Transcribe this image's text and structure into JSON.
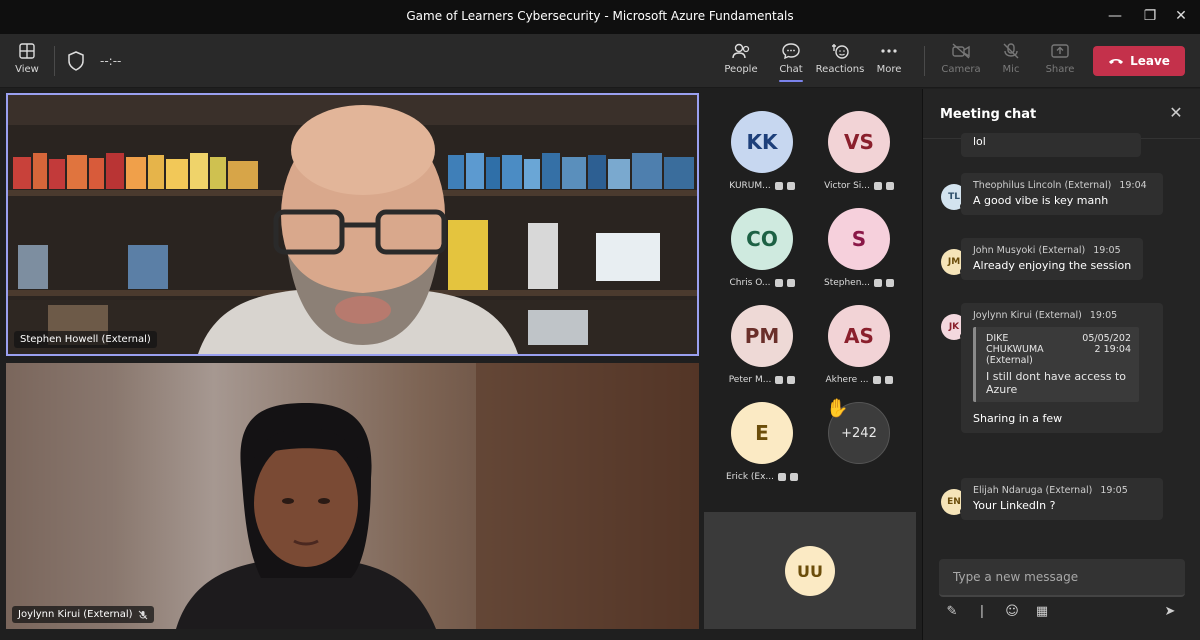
{
  "window": {
    "title": "Game of Learners Cybersecurity - Microsoft Azure Fundamentals"
  },
  "toolbar": {
    "view_label": "View",
    "timer": "--:--",
    "people_label": "People",
    "chat_label": "Chat",
    "reactions_label": "Reactions",
    "more_label": "More",
    "camera_label": "Camera",
    "mic_label": "Mic",
    "share_label": "Share",
    "leave_label": "Leave"
  },
  "videos": [
    {
      "name": "Stephen Howell (External)"
    },
    {
      "name": "Joylynn Kirui (External)"
    }
  ],
  "participants": [
    {
      "initials": "KK",
      "name": "KURUM...",
      "bg": "#c7d7f0",
      "fg": "#1d3f7a"
    },
    {
      "initials": "VS",
      "name": "Victor Si...",
      "bg": "#f2d3d6",
      "fg": "#8a1f2c"
    },
    {
      "initials": "CO",
      "name": "Chris O...",
      "bg": "#cfeadf",
      "fg": "#1d6144"
    },
    {
      "initials": "S",
      "name": "Stephen...",
      "bg": "#f6d0dc",
      "fg": "#8a1747"
    },
    {
      "initials": "PM",
      "name": "Peter M...",
      "bg": "#eed9d6",
      "fg": "#6a2f2a"
    },
    {
      "initials": "AS",
      "name": "Akhere ...",
      "bg": "#f2d3d6",
      "fg": "#8a1f2c"
    },
    {
      "initials": "E",
      "name": "Erick (Ex...",
      "bg": "#fbeac4",
      "fg": "#6b4d0a"
    }
  ],
  "overflow": {
    "count": "+242"
  },
  "self_tile": {
    "initials": "UU"
  },
  "chat": {
    "title": "Meeting chat",
    "partial_text": "lol",
    "messages": [
      {
        "initials": "TL",
        "name": "Theophilus Lincoln (External)",
        "time": "19:04",
        "text": "A good vibe is key manh",
        "bg": "#d3e3ef",
        "fg": "#2d4f6b",
        "dot": "#c7c7c7"
      },
      {
        "initials": "JM",
        "name": "John Musyoki (External)",
        "time": "19:05",
        "text": "Already enjoying the session",
        "bg": "#f5e4b8",
        "fg": "#6b4d0a",
        "dot": "#c7c7c7"
      },
      {
        "initials": "JK",
        "name": "Joylynn Kirui (External)",
        "time": "19:05",
        "text": "Sharing in a few",
        "bg": "#f3d8de",
        "fg": "#8a1f2c",
        "dot": "#c4314b",
        "quote": {
          "author_line1": "DIKE",
          "date": "05/05/202",
          "author_line2": "CHUKWUMA",
          "time": "2 19:04",
          "author_line3": "(External)",
          "text": "I still dont have access to Azure"
        }
      },
      {
        "initials": "EN",
        "name": "Elijah Ndaruga (External)",
        "time": "19:05",
        "text": "Your LinkedIn ?",
        "bg": "#f5e4b8",
        "fg": "#6b4d0a",
        "dot": "#c7c7c7"
      }
    ],
    "input_placeholder": "Type a new message"
  }
}
